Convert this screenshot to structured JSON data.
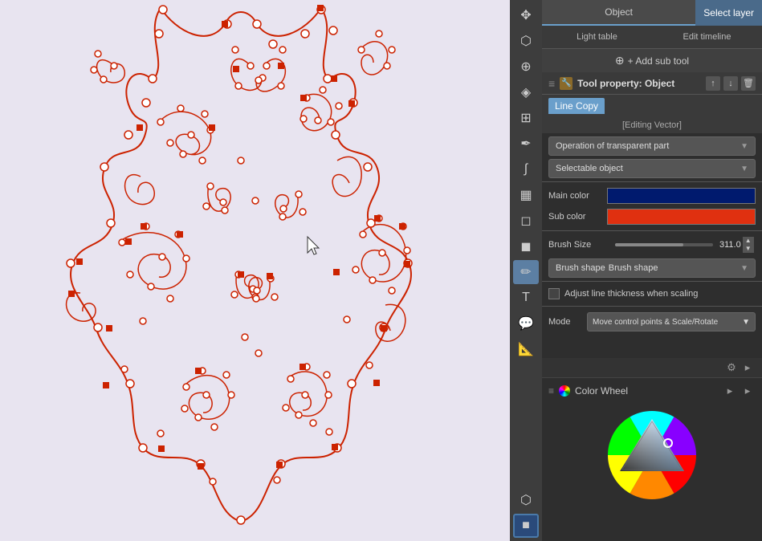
{
  "canvas": {
    "background_color": "#e8e4f0"
  },
  "toolbar": {
    "tools": [
      {
        "name": "move",
        "icon": "✥",
        "active": false
      },
      {
        "name": "lasso",
        "icon": "⬡",
        "active": false
      },
      {
        "name": "zoom",
        "icon": "🔍",
        "active": false
      },
      {
        "name": "color-pick",
        "icon": "◈",
        "active": false
      },
      {
        "name": "layer-move",
        "icon": "⊞",
        "active": false
      },
      {
        "name": "pen",
        "icon": "✒",
        "active": false
      },
      {
        "name": "brush",
        "icon": "🖌",
        "active": false
      },
      {
        "name": "fill",
        "icon": "🪣",
        "active": false
      },
      {
        "name": "eraser",
        "icon": "⬜",
        "active": false
      },
      {
        "name": "select",
        "icon": "⬛",
        "active": false
      },
      {
        "name": "vector",
        "icon": "✏",
        "active": true
      },
      {
        "name": "text",
        "icon": "T",
        "active": false
      },
      {
        "name": "bubble",
        "icon": "💬",
        "active": false
      },
      {
        "name": "ruler",
        "icon": "📐",
        "active": false
      },
      {
        "name": "layer",
        "icon": "⬡",
        "active": false
      },
      {
        "name": "color-active",
        "icon": "■",
        "active": true
      }
    ]
  },
  "panel": {
    "top_tabs": [
      {
        "label": "Object",
        "active": true
      },
      {
        "label": "Select layer",
        "active": false,
        "highlighted": true
      }
    ],
    "second_tabs": [
      {
        "label": "Light table",
        "active": false
      },
      {
        "label": "Edit timeline",
        "active": false
      }
    ],
    "add_sub_tool": "+ Add sub tool",
    "tool_property_title": "Tool property: Object",
    "tool_property_icon": "🔧",
    "active_tab": "Line Copy",
    "editing_vector_label": "[Editing Vector]",
    "operation_dropdown": {
      "label": "Operation of transparent part",
      "value": "Operation of transparent part",
      "options": [
        "Operation of transparent part"
      ]
    },
    "selectable_object_dropdown": {
      "label": "Selectable object",
      "value": "Selectable object",
      "options": [
        "Selectable object"
      ]
    },
    "main_color_label": "Main color",
    "main_color_value": "#001a6e",
    "sub_color_label": "Sub color",
    "sub_color_value": "#e03010",
    "brush_size_label": "Brush Size",
    "brush_size_value": "311.0",
    "brush_shape_label": "Brush shape",
    "brush_shape_value": "",
    "adjust_line_thickness_label": "Adjust line thickness when scaling",
    "adjust_line_thickness_checked": false,
    "mode_label": "Mode",
    "mode_value": "Move control points & Scale/Rotate",
    "color_wheel_title": "Color Wheel"
  }
}
